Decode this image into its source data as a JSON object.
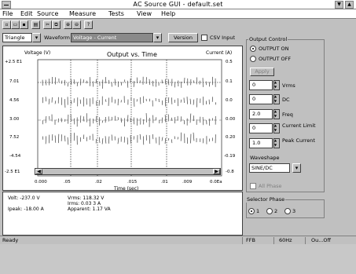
{
  "window": {
    "title": "AC Source GUI - default.set"
  },
  "menu": [
    "File",
    "Edit",
    "Source",
    "Measure",
    "Tests",
    "View",
    "Help"
  ],
  "toolbar": {
    "icons": [
      "new-icon",
      "open-icon",
      "save-icon",
      "print-icon",
      "cut-icon",
      "copy-icon",
      "zoom-in-icon",
      "zoom-out-icon",
      "help-icon"
    ]
  },
  "controls": {
    "mode_value": "Triangle",
    "waveform_label": "Waveform",
    "waveform_value": "Voltage - Current",
    "version_button": "Version",
    "checkbox_label": "CSV Input"
  },
  "plot": {
    "title": "Output vs. Time",
    "left_axis_label": "Voltage (V)",
    "right_axis_label": "Current (A)",
    "x_axis_label": "Time (sec)",
    "y_left_ticks": [
      "+2.5 E1",
      "7.01",
      "4.56",
      "3.00",
      "7.52",
      "-4.54",
      "-2.5 E1"
    ],
    "y_right_ticks": [
      "0.5",
      "0.1",
      "0.0",
      "0.00",
      "0.20",
      "-0.19",
      "-0.8"
    ],
    "x_ticks": [
      "0.000",
      ".05",
      ".02",
      ".015",
      ".01",
      ".009",
      "0.0Ea"
    ]
  },
  "readouts": {
    "line1_left": "Volt: -237.0 V",
    "line1_mid": "Vrms: 118.32 V",
    "line2_mid": "Irms: 0.03 3 A",
    "line3_left": "Ipeak: -18.00 A",
    "line3_mid": "Apparent: 1.17 VA"
  },
  "output_control": {
    "group_title": "Output Control",
    "radio_on": "OUTPUT ON",
    "radio_off": "OUTPUT OFF",
    "apply_button": "Apply",
    "fields": [
      {
        "value": "0",
        "label": "Vrms"
      },
      {
        "value": "0",
        "label": "DC"
      },
      {
        "value": "2.0",
        "label": "Freq"
      },
      {
        "value": "0",
        "label": "Current Limit"
      },
      {
        "value": "1.0",
        "label": "Peak Current"
      }
    ],
    "waveshape_label": "Waveshape",
    "waveshape_value": "SINE/DC",
    "all_phase_label": "All Phase"
  },
  "selector": {
    "group_title": "Selector Phase",
    "options": [
      "1",
      "2",
      "3"
    ]
  },
  "status": {
    "left": "Ready",
    "cells": [
      "FFB",
      "60Hz",
      "Ou...Off"
    ]
  },
  "colors": {
    "background": "#c0c0c0",
    "panel": "#ffffff",
    "trace": "#404040"
  }
}
